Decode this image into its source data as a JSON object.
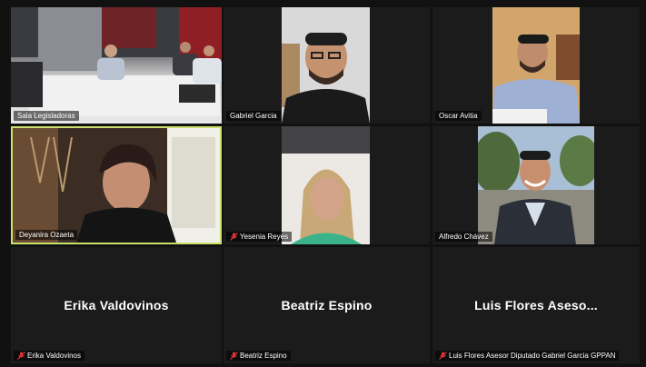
{
  "meeting": {
    "tiles": [
      {
        "name": "Sala Legisladoras",
        "muted": false,
        "video": true
      },
      {
        "name": "Gabriel Garcia",
        "muted": false,
        "video": true
      },
      {
        "name": "Oscar Avitia",
        "muted": false,
        "video": true
      },
      {
        "name": "Deyanira Ozaeta",
        "muted": false,
        "video": true,
        "active_speaker": true
      },
      {
        "name": "Yesenia Reyes",
        "muted": true,
        "video": true
      },
      {
        "name": "Alfredo Chávez",
        "muted": false,
        "video": true
      },
      {
        "name": "Erika Valdovinos",
        "display_name": "Erika Valdovinos",
        "muted": true,
        "video": false
      },
      {
        "name": "Beatriz Espino",
        "display_name": "Beatriz Espino",
        "muted": true,
        "video": false
      },
      {
        "name": "Luis Flores Asesor Diputado Gabriel Garcia GPPAN",
        "display_name": "Luis Flores Aseso...",
        "muted": true,
        "video": false
      }
    ]
  },
  "colors": {
    "active_speaker_border": "#c9e26b",
    "muted_icon": "#e0353b",
    "tile_background": "#1b1b1b"
  },
  "icons": {
    "muted": "microphone-muted-icon"
  }
}
